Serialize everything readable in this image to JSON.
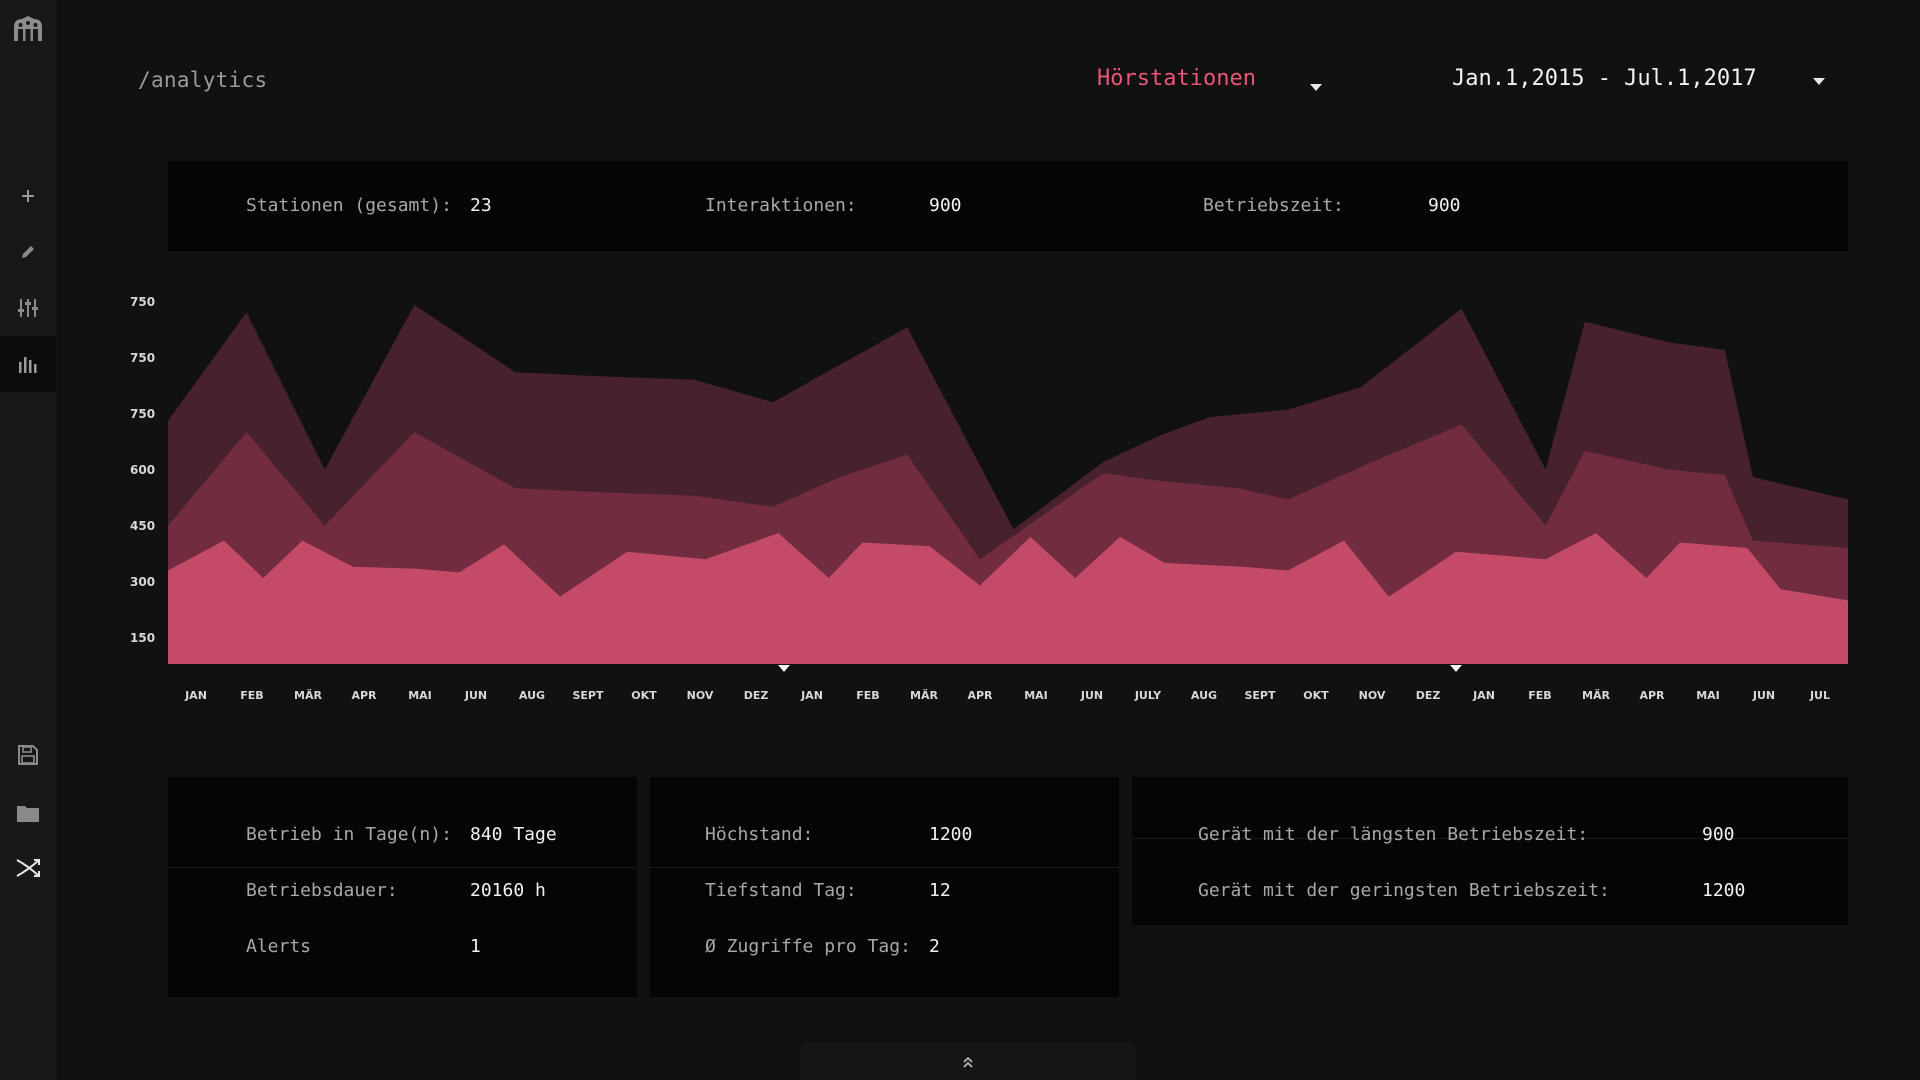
{
  "header": {
    "breadcrumb": "/analytics",
    "station_select": "Hörstationen",
    "date_range": "Jan.1,2015 - Jul.1,2017"
  },
  "sidebar": {
    "items": [
      {
        "name": "add",
        "icon": "plus-icon"
      },
      {
        "name": "edit",
        "icon": "pencil-icon"
      },
      {
        "name": "settings",
        "icon": "sliders-icon"
      },
      {
        "name": "analytics",
        "icon": "bar-chart-icon",
        "active": true
      },
      {
        "name": "save",
        "icon": "floppy-disk-icon"
      },
      {
        "name": "open",
        "icon": "folder-icon"
      },
      {
        "name": "close",
        "icon": "crossed-arrows-icon"
      }
    ]
  },
  "summary": {
    "stations_label": "Stationen (gesamt):",
    "stations_value": "23",
    "interactions_label": "Interaktionen:",
    "interactions_value": "900",
    "uptime_label": "Betriebszeit:",
    "uptime_value": "900"
  },
  "chart_data": {
    "type": "area",
    "title": "",
    "xlabel": "",
    "ylabel": "",
    "y_tick_labels": [
      "750",
      "750",
      "750",
      "600",
      "450",
      "300",
      "150"
    ],
    "categories": [
      "JAN",
      "FEB",
      "MÄR",
      "APR",
      "MAI",
      "JUN",
      "AUG",
      "SEPT",
      "OKT",
      "NOV",
      "DEZ",
      "JAN",
      "FEB",
      "MÄR",
      "APR",
      "MAI",
      "JUN",
      "JULY",
      "AUG",
      "SEPT",
      "OKT",
      "NOV",
      "DEZ",
      "JAN",
      "FEB",
      "MÄR",
      "APR",
      "MAI",
      "JUN",
      "JUL"
    ],
    "year_markers_after": [
      "DEZ",
      "DEZ"
    ],
    "series": [
      {
        "color": "#47212b",
        "points": [
          [
            0,
            650
          ],
          [
            1.4,
            940
          ],
          [
            2.8,
            520
          ],
          [
            4.4,
            960
          ],
          [
            6.2,
            780
          ],
          [
            7.6,
            770
          ],
          [
            9.4,
            760
          ],
          [
            10.8,
            700
          ],
          [
            12.0,
            800
          ],
          [
            13.2,
            900
          ],
          [
            15.1,
            360
          ],
          [
            16.7,
            540
          ],
          [
            17.7,
            610
          ],
          [
            18.6,
            660
          ],
          [
            20.0,
            680
          ],
          [
            21.3,
            740
          ],
          [
            23.1,
            950
          ],
          [
            24.6,
            520
          ],
          [
            25.3,
            915
          ],
          [
            26.8,
            860
          ],
          [
            27.8,
            840
          ],
          [
            28.3,
            500
          ],
          [
            30.0,
            440
          ]
        ]
      },
      {
        "color": "#722c40",
        "points": [
          [
            0,
            370
          ],
          [
            1.4,
            620
          ],
          [
            2.8,
            370
          ],
          [
            4.4,
            620
          ],
          [
            6.2,
            470
          ],
          [
            7.6,
            460
          ],
          [
            9.4,
            450
          ],
          [
            10.8,
            420
          ],
          [
            12.0,
            500
          ],
          [
            13.2,
            560
          ],
          [
            14.5,
            280
          ],
          [
            16.7,
            510
          ],
          [
            17.7,
            490
          ],
          [
            19.1,
            470
          ],
          [
            20.0,
            440
          ],
          [
            21.5,
            540
          ],
          [
            23.1,
            640
          ],
          [
            24.6,
            370
          ],
          [
            25.3,
            570
          ],
          [
            26.8,
            520
          ],
          [
            27.8,
            505
          ],
          [
            28.3,
            330
          ],
          [
            30.0,
            310
          ]
        ]
      },
      {
        "color": "#c34b68",
        "points": [
          [
            0,
            250
          ],
          [
            1.0,
            330
          ],
          [
            1.7,
            230
          ],
          [
            2.4,
            330
          ],
          [
            3.3,
            260
          ],
          [
            4.4,
            255
          ],
          [
            5.2,
            245
          ],
          [
            6.0,
            320
          ],
          [
            7.0,
            180
          ],
          [
            8.2,
            300
          ],
          [
            9.6,
            280
          ],
          [
            10.9,
            350
          ],
          [
            11.8,
            230
          ],
          [
            12.4,
            325
          ],
          [
            13.6,
            315
          ],
          [
            14.5,
            210
          ],
          [
            15.4,
            340
          ],
          [
            16.2,
            230
          ],
          [
            17.0,
            340
          ],
          [
            17.8,
            270
          ],
          [
            19.2,
            260
          ],
          [
            20.0,
            250
          ],
          [
            21.0,
            330
          ],
          [
            21.8,
            180
          ],
          [
            23.0,
            300
          ],
          [
            24.6,
            280
          ],
          [
            25.5,
            350
          ],
          [
            26.4,
            230
          ],
          [
            27.0,
            325
          ],
          [
            28.2,
            310
          ],
          [
            28.8,
            200
          ],
          [
            30.0,
            170
          ]
        ]
      }
    ]
  },
  "cards": {
    "operation": {
      "days_label": "Betrieb in Tage(n):",
      "days_value": "840 Tage",
      "duration_label": "Betriebsdauer:",
      "duration_value": "20160 h",
      "alerts_label": "Alerts",
      "alerts_value": "1"
    },
    "stats": {
      "peak_label": "Höchstand:",
      "peak_value": "1200",
      "low_label": "Tiefstand Tag:",
      "low_value": "12",
      "avg_label": "Ø Zugriffe pro Tag:",
      "avg_value": "2"
    },
    "devices": {
      "longest_label": "Gerät mit der längsten Betriebszeit:",
      "longest_value": "900",
      "shortest_label": "Gerät mit der geringsten Betriebszeit:",
      "shortest_value": "1200"
    }
  },
  "colors": {
    "accent": "#e85675",
    "background": "#111111",
    "panel": "#050505"
  }
}
